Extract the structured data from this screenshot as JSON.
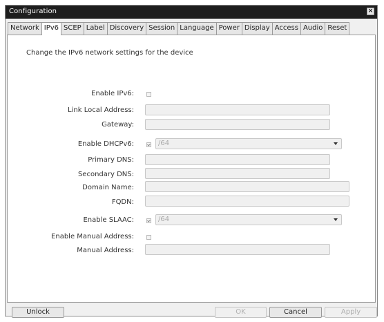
{
  "window": {
    "title": "Configuration",
    "close_glyph": "×"
  },
  "tabs": [
    {
      "label": "Network"
    },
    {
      "label": "IPv6",
      "active": true
    },
    {
      "label": "SCEP"
    },
    {
      "label": "Label"
    },
    {
      "label": "Discovery"
    },
    {
      "label": "Session"
    },
    {
      "label": "Language"
    },
    {
      "label": "Power"
    },
    {
      "label": "Display"
    },
    {
      "label": "Access"
    },
    {
      "label": "Audio"
    },
    {
      "label": "Reset"
    }
  ],
  "description": "Change the IPv6 network settings for the device",
  "form": {
    "enable_ipv6": {
      "label": "Enable IPv6:",
      "checked": false
    },
    "link_local": {
      "label": "Link Local Address:",
      "value": ""
    },
    "gateway": {
      "label": "Gateway:",
      "value": ""
    },
    "enable_dhcpv6": {
      "label": "Enable DHCPv6:",
      "checked": true,
      "select_value": "/64"
    },
    "primary_dns": {
      "label": "Primary DNS:",
      "value": ""
    },
    "secondary_dns": {
      "label": "Secondary DNS:",
      "value": ""
    },
    "domain_name": {
      "label": "Domain Name:",
      "value": ""
    },
    "fqdn": {
      "label": "FQDN:",
      "value": ""
    },
    "enable_slaac": {
      "label": "Enable SLAAC:",
      "checked": true,
      "select_value": "/64"
    },
    "enable_manual": {
      "label": "Enable Manual Address:",
      "checked": false
    },
    "manual_address": {
      "label": "Manual Address:",
      "value": ""
    }
  },
  "buttons": {
    "unlock": "Unlock",
    "ok": "OK",
    "cancel": "Cancel",
    "apply": "Apply"
  }
}
